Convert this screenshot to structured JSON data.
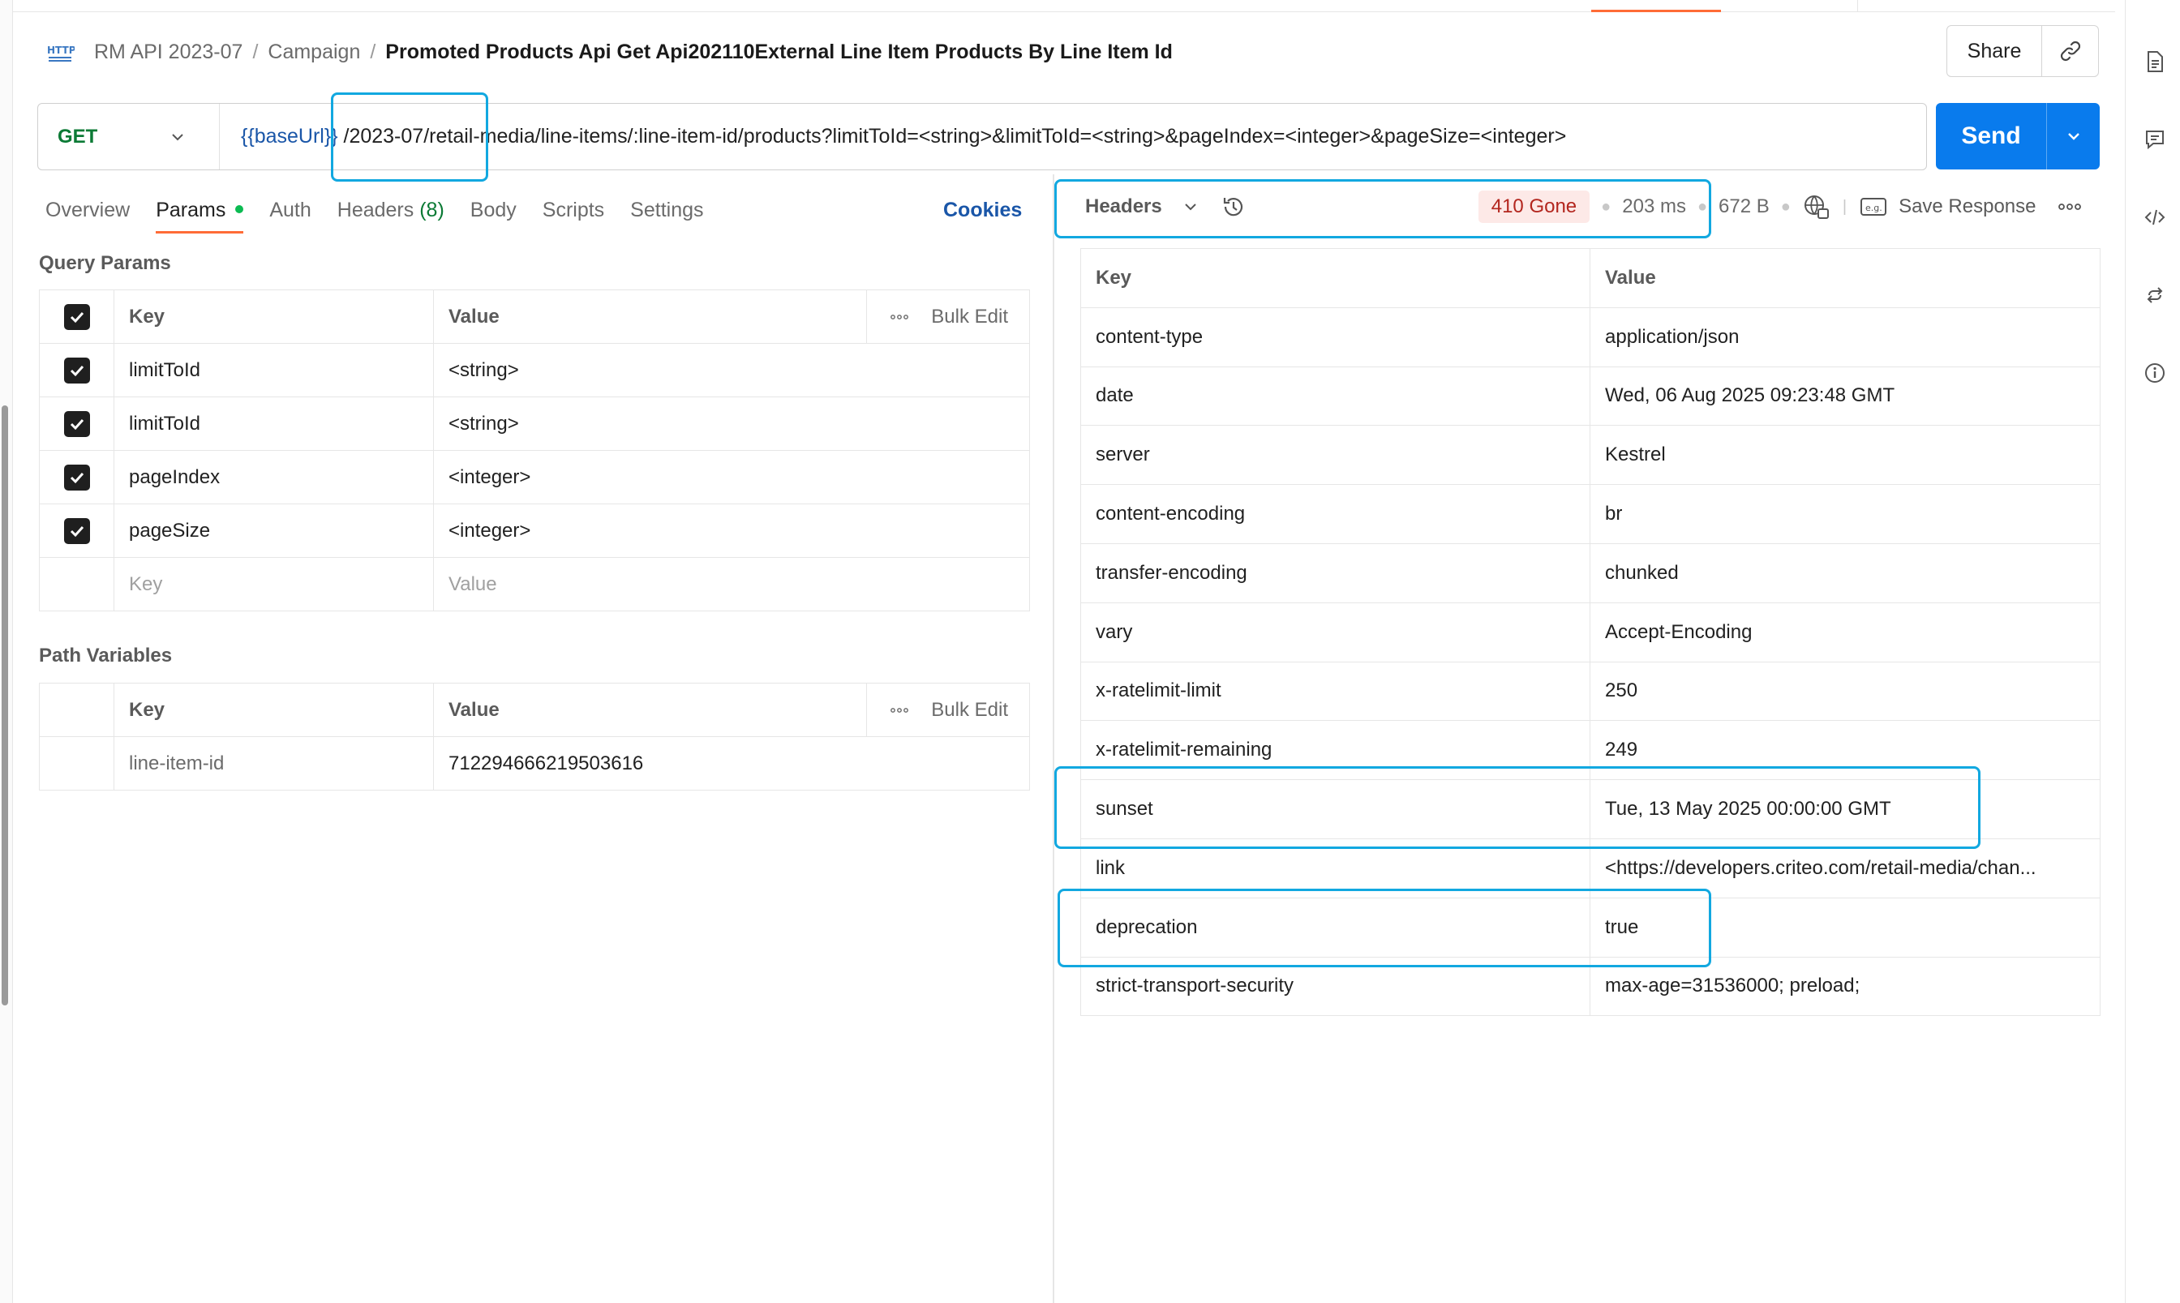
{
  "breadcrumb": {
    "items": [
      "RM API 2023-07",
      "Campaign"
    ],
    "separator": "/",
    "title": "Promoted Products Api Get Api202110External Line Item Products By Line Item Id",
    "icon": "http-icon"
  },
  "header_actions": {
    "share_label": "Share",
    "link_icon": "link-icon"
  },
  "request": {
    "method": "GET",
    "url_variable": "{{baseUrl}}",
    "url_path": "/2023-07/retail-media/line-items/:line-item-id/products?limitToId=<string>&limitToId=<string>&pageIndex=<integer>&pageSize=<integer>",
    "send_label": "Send"
  },
  "tabs": [
    {
      "label": "Overview"
    },
    {
      "label": "Params",
      "active": true,
      "dot": true
    },
    {
      "label": "Auth"
    },
    {
      "label": "Headers",
      "count": "(8)"
    },
    {
      "label": "Body"
    },
    {
      "label": "Scripts"
    },
    {
      "label": "Settings"
    }
  ],
  "cookies_label": "Cookies",
  "query_params": {
    "title": "Query Params",
    "headers": {
      "key": "Key",
      "value": "Value",
      "bulk_edit": "Bulk Edit"
    },
    "rows": [
      {
        "key": "limitToId",
        "value": "<string>",
        "checked": true
      },
      {
        "key": "limitToId",
        "value": "<string>",
        "checked": true
      },
      {
        "key": "pageIndex",
        "value": "<integer>",
        "checked": true
      },
      {
        "key": "pageSize",
        "value": "<integer>",
        "checked": true
      }
    ],
    "placeholder": {
      "key": "Key",
      "value": "Value"
    }
  },
  "path_variables": {
    "title": "Path Variables",
    "headers": {
      "key": "Key",
      "value": "Value",
      "bulk_edit": "Bulk Edit"
    },
    "rows": [
      {
        "key": "line-item-id",
        "value": "712294666219503616"
      }
    ]
  },
  "response": {
    "view_label": "Headers",
    "status": "410 Gone",
    "time": "203 ms",
    "size": "672 B",
    "save_label": "Save Response",
    "headers_table": {
      "col_key": "Key",
      "col_value": "Value",
      "rows": [
        {
          "key": "content-type",
          "value": "application/json"
        },
        {
          "key": "date",
          "value": "Wed, 06 Aug 2025 09:23:48 GMT"
        },
        {
          "key": "server",
          "value": "Kestrel"
        },
        {
          "key": "content-encoding",
          "value": "br"
        },
        {
          "key": "transfer-encoding",
          "value": "chunked"
        },
        {
          "key": "vary",
          "value": "Accept-Encoding"
        },
        {
          "key": "x-ratelimit-limit",
          "value": "250"
        },
        {
          "key": "x-ratelimit-remaining",
          "value": "249"
        },
        {
          "key": "sunset",
          "value": "Tue, 13 May 2025 00:00:00 GMT"
        },
        {
          "key": "link",
          "value": "<https://developers.criteo.com/retail-media/chan..."
        },
        {
          "key": "deprecation",
          "value": "true"
        },
        {
          "key": "strict-transport-security",
          "value": "max-age=31536000; preload;"
        }
      ]
    }
  },
  "colors": {
    "accent": "#ff6c37",
    "send": "#097bed",
    "method": "#0b7a35",
    "status_error": "#b3261e",
    "highlight": "#12a8e0"
  }
}
